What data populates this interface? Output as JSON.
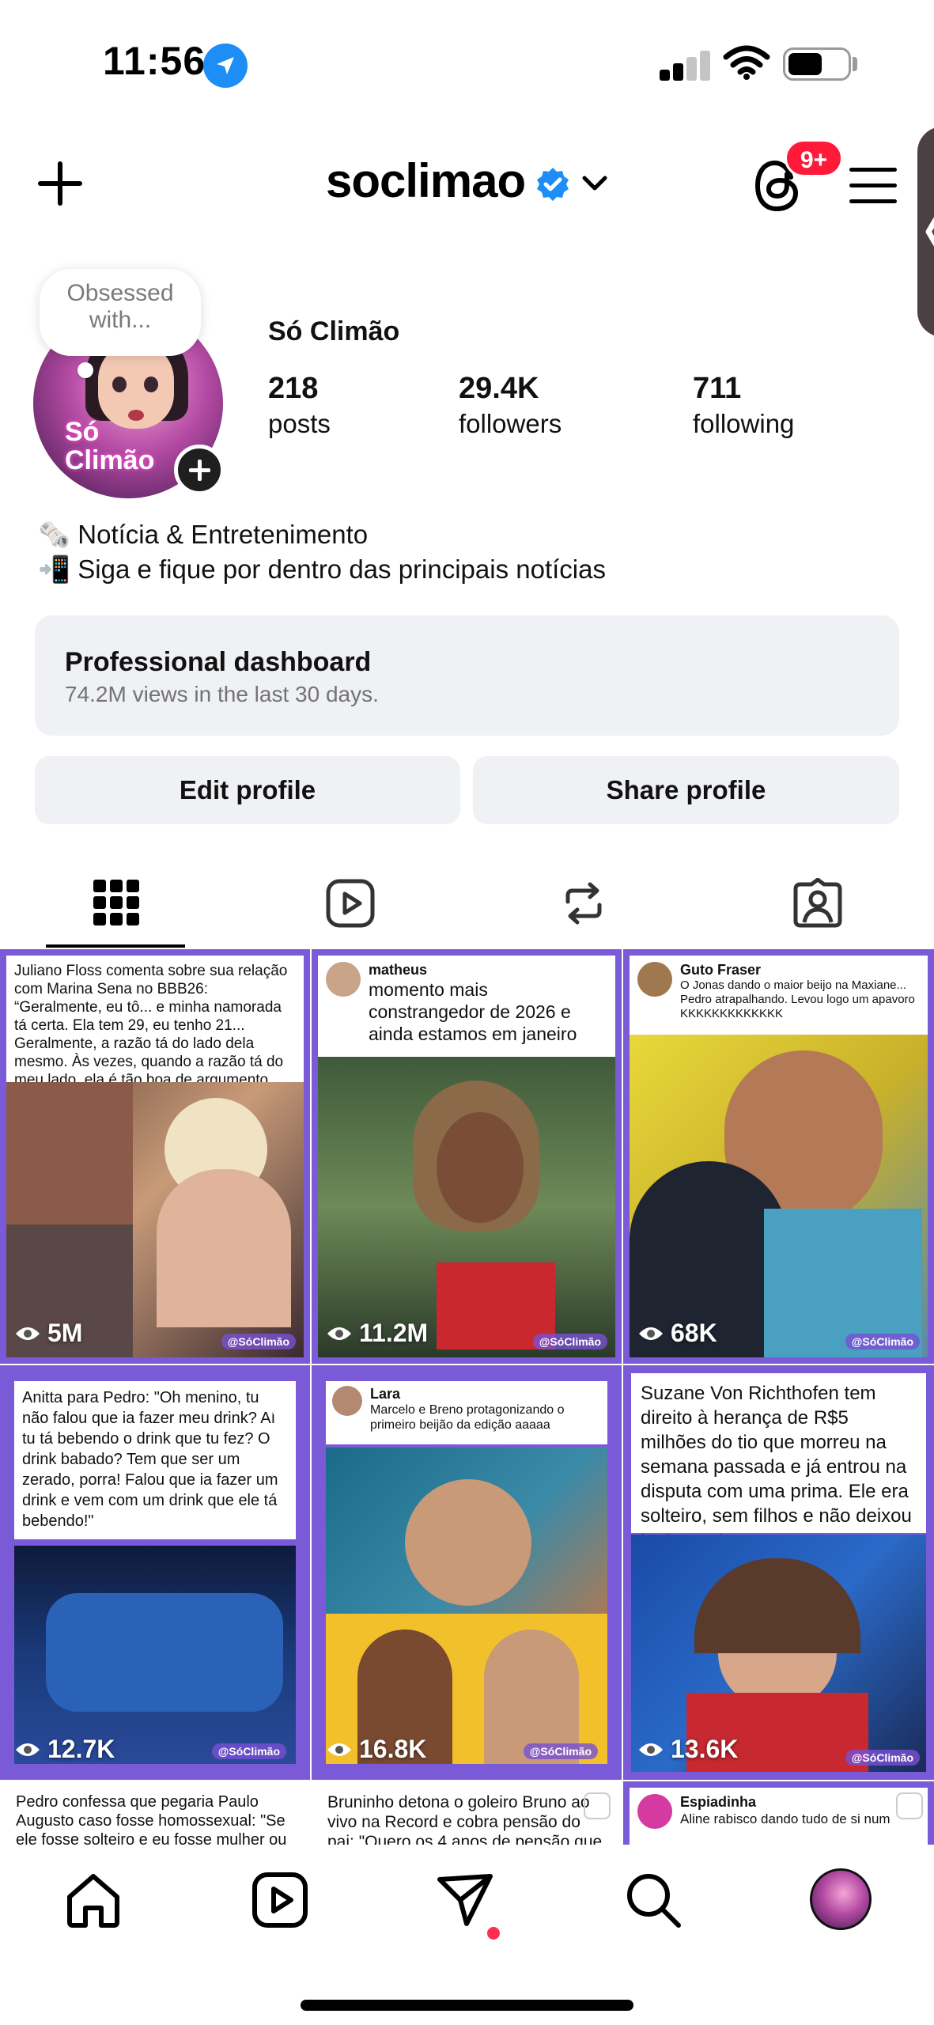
{
  "status_bar": {
    "time": "11:56"
  },
  "header": {
    "username": "soclimao",
    "notification_badge": "9+"
  },
  "profile": {
    "note": [
      "Obsessed",
      "with..."
    ],
    "avatar_text": [
      "Só",
      "Climão"
    ],
    "display_name": "Só Climão",
    "stats": [
      {
        "count": "218",
        "label": "posts"
      },
      {
        "count": "29.4K",
        "label": "followers"
      },
      {
        "count": "711",
        "label": "following"
      }
    ],
    "bio": [
      "🗞️ Notícia & Entretenimento",
      "📲 Siga e fique por dentro das principais notícias"
    ]
  },
  "dashboard": {
    "title": "Professional dashboard",
    "subtitle": "74.2M views in the last 30 days."
  },
  "actions": {
    "edit_label": "Edit profile",
    "share_label": "Share profile"
  },
  "tabs": [
    "grid-icon",
    "reels-icon",
    "reposts-icon",
    "tagged-icon"
  ],
  "posts": [
    {
      "text": "Juliano Floss comenta sobre sua relação com Marina Sena no BBB26: “Geralmente, eu tô... e minha namorada tá certa. Ela tem 29, eu tenho 21... Geralmente, a razão tá do lado dela mesmo. Às vezes, quando a razão tá do meu lado, ela é tão boa de argumento que me faz pensar que eu tô errado.”",
      "views": "5M",
      "watermark": "@SóClimão"
    },
    {
      "user": "matheus",
      "text": "momento mais constrangedor de 2026 e ainda estamos em janeiro",
      "views": "11.2M",
      "watermark": "@SóClimão"
    },
    {
      "user": "Guto Fraser",
      "text": "O Jonas dando o maior beijo na Maxiane... Pedro atrapalhando. Levou logo um apavoro KKKKKKKKKKKKK",
      "views": "68K",
      "watermark": "@SóClimão"
    },
    {
      "text": "Anitta para Pedro: \"Oh menino, tu não falou que ia fazer meu drink? Aí tu tá bebendo o drink que tu fez? O drink babado? Tem que ser um zerado, porra! Falou que ia fazer um drink e vem com um drink que ele tá bebendo!\"",
      "views": "12.7K",
      "watermark": "@SóClimão"
    },
    {
      "user": "Lara",
      "text": "Marcelo e Breno protagonizando o primeiro beijão da edição aaaaa",
      "views": "16.8K",
      "watermark": "@SóClimão"
    },
    {
      "text": "Suzane Von Richthofen tem direito à herança de R$5 milhões do tio que morreu na semana passada e já entrou na disputa com uma prima. Ele era solteiro, sem filhos e não deixou testamento",
      "views": "13.6K",
      "watermark": "@SóClimão"
    },
    {
      "text": "Pedro confessa que pegaria Paulo Augusto caso fosse homossexual: \"Se ele fosse solteiro e eu fosse mulher ou homossexual,"
    },
    {
      "text": "Bruninho detona o goleiro Bruno ao vivo na Record e cobra pensão do pai: \"Quero os 4 anos de pensão que tá"
    },
    {
      "user": "Espiadinha",
      "text": "Aline rabisco dando tudo de si num"
    }
  ],
  "colors": {
    "accent_purple": "#7a5ad6",
    "badge_red": "#ff1a3a",
    "verified_blue": "#1c8ef5",
    "card_bg": "#eff1f4"
  },
  "bottom_nav": [
    "home-icon",
    "reels-icon",
    "direct-icon",
    "search-icon",
    "profile-avatar"
  ]
}
